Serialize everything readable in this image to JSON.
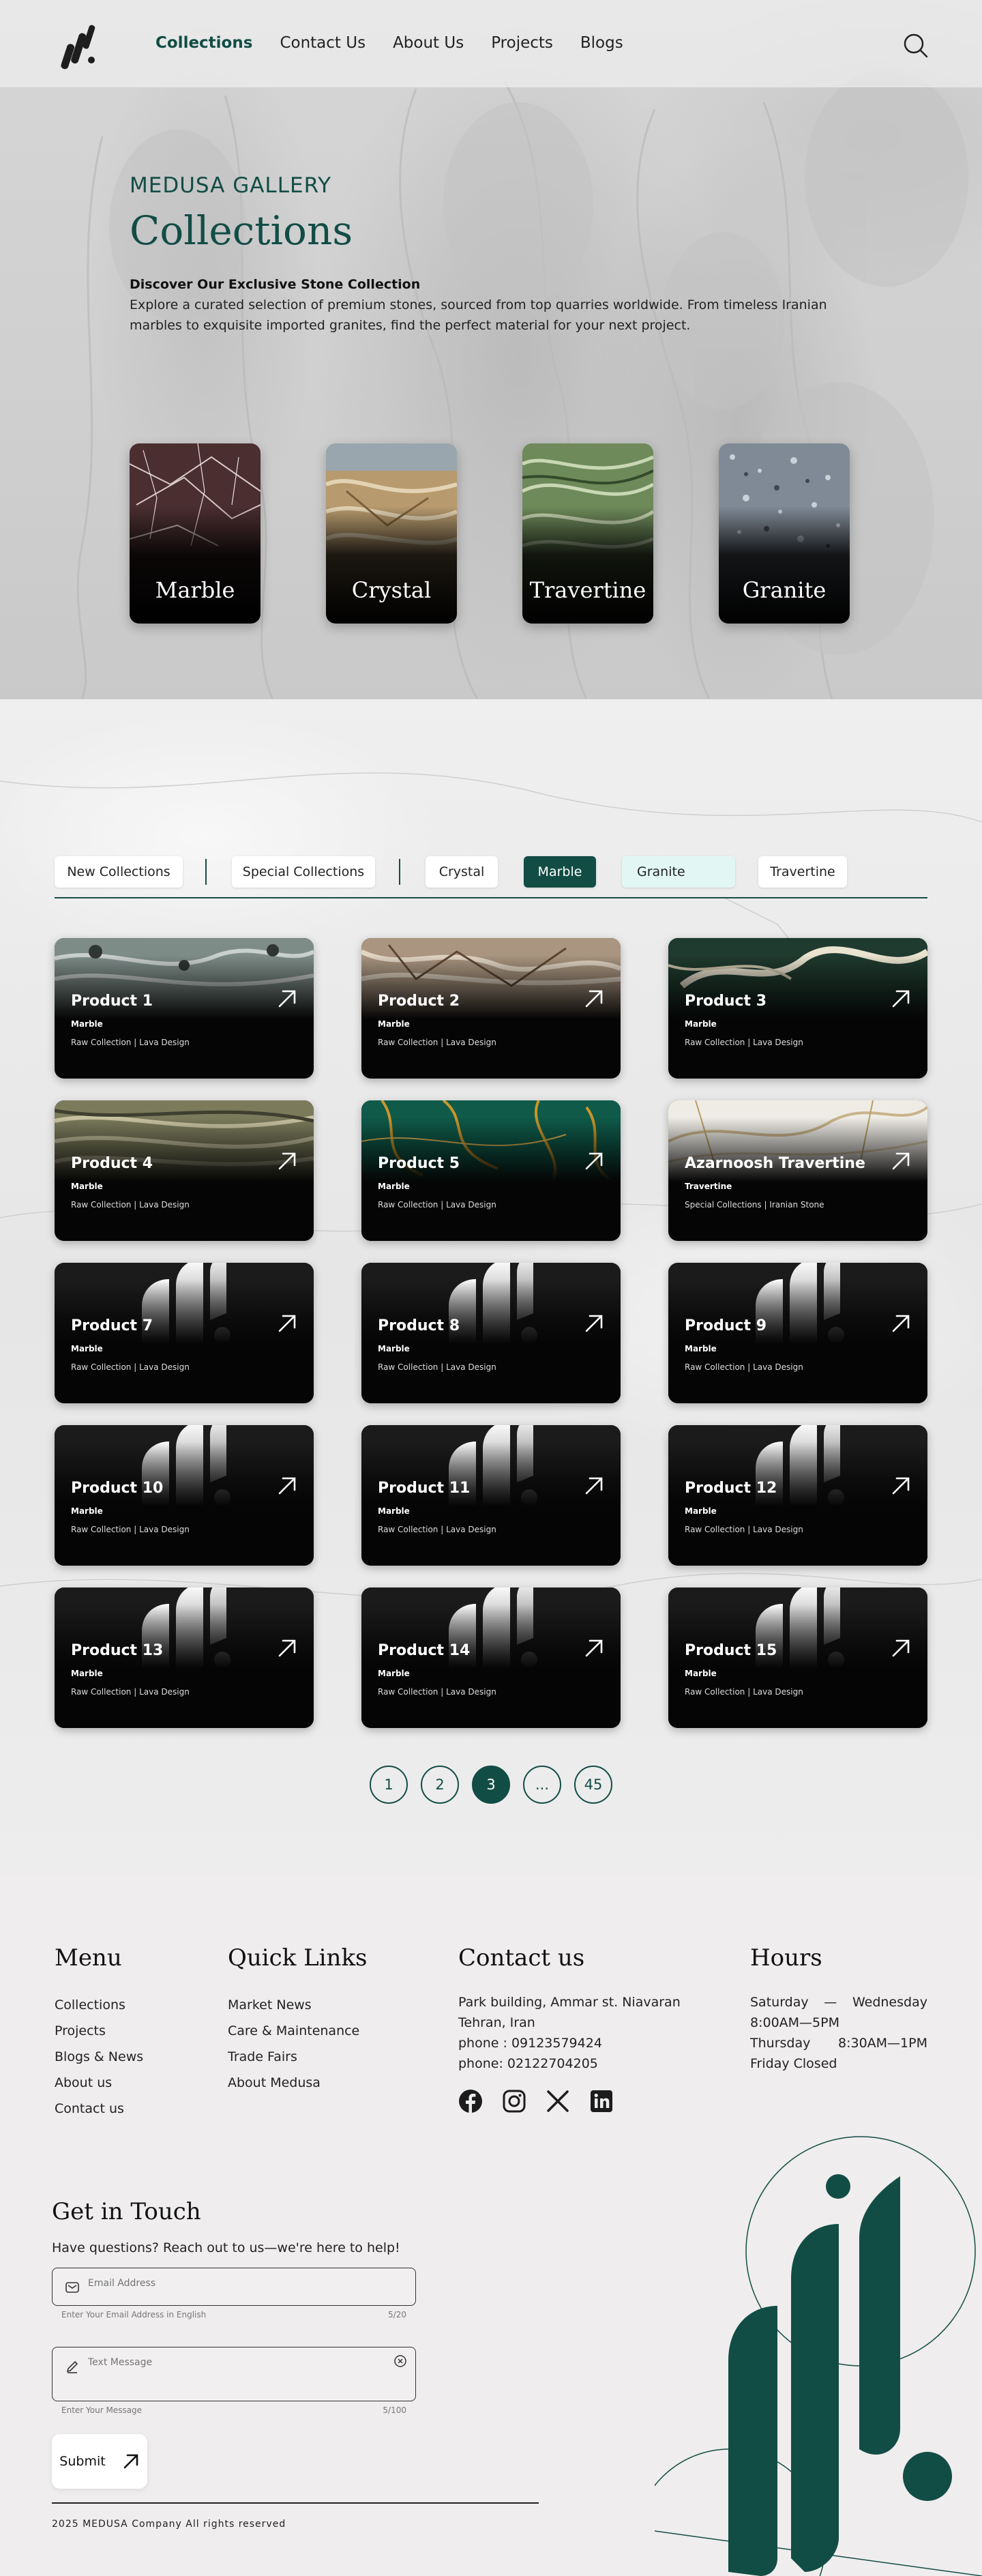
{
  "nav": {
    "links": [
      "Collections",
      "Contact Us",
      "About Us",
      "Projects",
      "Blogs"
    ],
    "active": "Collections"
  },
  "hero": {
    "eyebrow": "MEDUSA GALLERY",
    "title": "Collections",
    "subtitle": "Discover Our Exclusive Stone Collection",
    "description": "Explore a curated selection of premium stones, sourced from top quarries worldwide. From timeless Iranian marbles to exquisite imported granites, find the perfect material for your next project.",
    "categories": [
      "Marble",
      "Crystal",
      "Travertine",
      "Granite"
    ]
  },
  "filters": {
    "chips": [
      "New Collections",
      "Special Collections",
      "Crystal",
      "Marble",
      "Granite",
      "Travertine"
    ],
    "active": "Marble",
    "hover": "Granite"
  },
  "products": [
    {
      "name": "Product 1",
      "type": "Marble",
      "meta": "Raw Collection | Lava Design",
      "texture": "stone-grey"
    },
    {
      "name": "Product 2",
      "type": "Marble",
      "meta": "Raw Collection | Lava Design",
      "texture": "stone-brown"
    },
    {
      "name": "Product 3",
      "type": "Marble",
      "meta": "Raw Collection | Lava Design",
      "texture": "stone-darkgreen"
    },
    {
      "name": "Product 4",
      "type": "Marble",
      "meta": "Raw Collection | Lava Design",
      "texture": "stone-olive"
    },
    {
      "name": "Product 5",
      "type": "Marble",
      "meta": "Raw Collection | Lava Design",
      "texture": "stone-emerald"
    },
    {
      "name": "Azarnoosh Travertine",
      "type": "Travertine",
      "meta": "Special Collections | Iranian Stone",
      "texture": "stone-white-gold"
    },
    {
      "name": "Product 7",
      "type": "Marble",
      "meta": "Raw Collection | Lava Design",
      "texture": "logo-placeholder"
    },
    {
      "name": "Product 8",
      "type": "Marble",
      "meta": "Raw Collection | Lava Design",
      "texture": "logo-placeholder"
    },
    {
      "name": "Product 9",
      "type": "Marble",
      "meta": "Raw Collection | Lava Design",
      "texture": "logo-placeholder"
    },
    {
      "name": "Product 10",
      "type": "Marble",
      "meta": "Raw Collection | Lava Design",
      "texture": "logo-placeholder"
    },
    {
      "name": "Product 11",
      "type": "Marble",
      "meta": "Raw Collection | Lava Design",
      "texture": "logo-placeholder"
    },
    {
      "name": "Product 12",
      "type": "Marble",
      "meta": "Raw Collection | Lava Design",
      "texture": "logo-placeholder"
    },
    {
      "name": "Product 13",
      "type": "Marble",
      "meta": "Raw Collection | Lava Design",
      "texture": "logo-placeholder"
    },
    {
      "name": "Product 14",
      "type": "Marble",
      "meta": "Raw Collection | Lava Design",
      "texture": "logo-placeholder"
    },
    {
      "name": "Product 15",
      "type": "Marble",
      "meta": "Raw Collection | Lava Design",
      "texture": "logo-placeholder"
    }
  ],
  "pagination": {
    "pages": [
      "1",
      "2",
      "3",
      "...",
      "45"
    ],
    "active": "3"
  },
  "footer": {
    "menu": {
      "title": "Menu",
      "links": [
        "Collections",
        "Projects",
        "Blogs & News",
        "About us",
        "Contact us"
      ]
    },
    "quick": {
      "title": "Quick Links",
      "links": [
        "Market News",
        "Care & Maintenance",
        "Trade Fairs",
        "About Medusa"
      ]
    },
    "contact": {
      "title": "Contact us",
      "lines": [
        "Park building, Ammar st. Niavaran",
        "Tehran, Iran",
        "phone : 09123579424",
        "phone: 02122704205"
      ],
      "socials": [
        "facebook-icon",
        "instagram-icon",
        "x-icon",
        "linkedin-icon"
      ]
    },
    "hours": {
      "title": "Hours",
      "rows": [
        [
          "Saturday",
          "—",
          "Wednesday"
        ],
        [
          "8:00AM—5PM",
          "",
          ""
        ],
        [
          "Thursday",
          "",
          "8:30AM—1PM"
        ],
        [
          "Friday Closed",
          "",
          ""
        ]
      ]
    },
    "git": {
      "title": "Get in Touch",
      "subtitle": "Have questions? Reach out to us—we're here to help!",
      "email_placeholder": "Email Address",
      "email_helper": "Enter Your Email Address in English",
      "email_count": "5/20",
      "message_placeholder": "Text Message",
      "message_helper": "Enter Your Message",
      "message_count": "5/100",
      "submit": "Submit"
    },
    "copyright": "2025 MEDUSA Company All rights reserved"
  },
  "colors": {
    "brand": "#124d45",
    "accent_hover": "#e2f7f3"
  }
}
